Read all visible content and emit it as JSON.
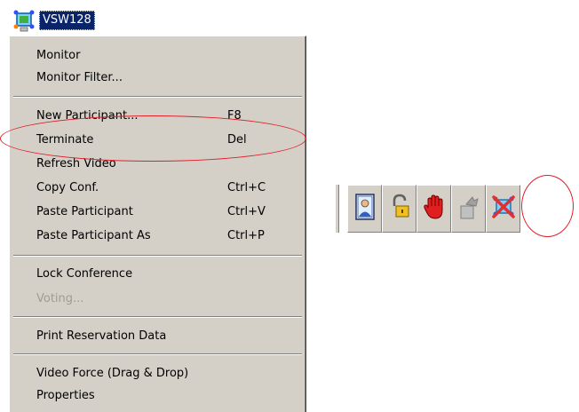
{
  "node": {
    "label": "VSW128",
    "icon": "conference-icon"
  },
  "menu": {
    "groups": [
      [
        {
          "label": "Monitor",
          "shortcut": ""
        },
        {
          "label": "Monitor Filter...",
          "shortcut": ""
        }
      ],
      [
        {
          "label": "New Participant...",
          "shortcut": "F8"
        },
        {
          "label": "Terminate",
          "shortcut": "Del"
        },
        {
          "label": "Refresh Video",
          "shortcut": ""
        },
        {
          "label": "Copy Conf.",
          "shortcut": "Ctrl+C"
        },
        {
          "label": "Paste Participant",
          "shortcut": "Ctrl+V"
        },
        {
          "label": "Paste Participant As",
          "shortcut": "Ctrl+P"
        }
      ],
      [
        {
          "label": "Lock Conference",
          "shortcut": ""
        },
        {
          "label": "Voting...",
          "shortcut": "",
          "disabled": true
        }
      ],
      [
        {
          "label": "Print Reservation Data",
          "shortcut": ""
        }
      ],
      [
        {
          "label": "Video Force (Drag & Drop)",
          "shortcut": ""
        },
        {
          "label": "Properties",
          "shortcut": ""
        }
      ]
    ]
  },
  "toolbar": {
    "buttons": [
      {
        "icon": "participant-properties-icon"
      },
      {
        "icon": "lock-icon"
      },
      {
        "icon": "stop-hand-icon"
      },
      {
        "icon": "move-participant-icon",
        "disabled": true
      },
      {
        "icon": "terminate-conference-icon"
      }
    ]
  },
  "colors": {
    "accent": "#e0202a",
    "selection": "#0a246a",
    "menu_bg": "#d4d0c8"
  }
}
